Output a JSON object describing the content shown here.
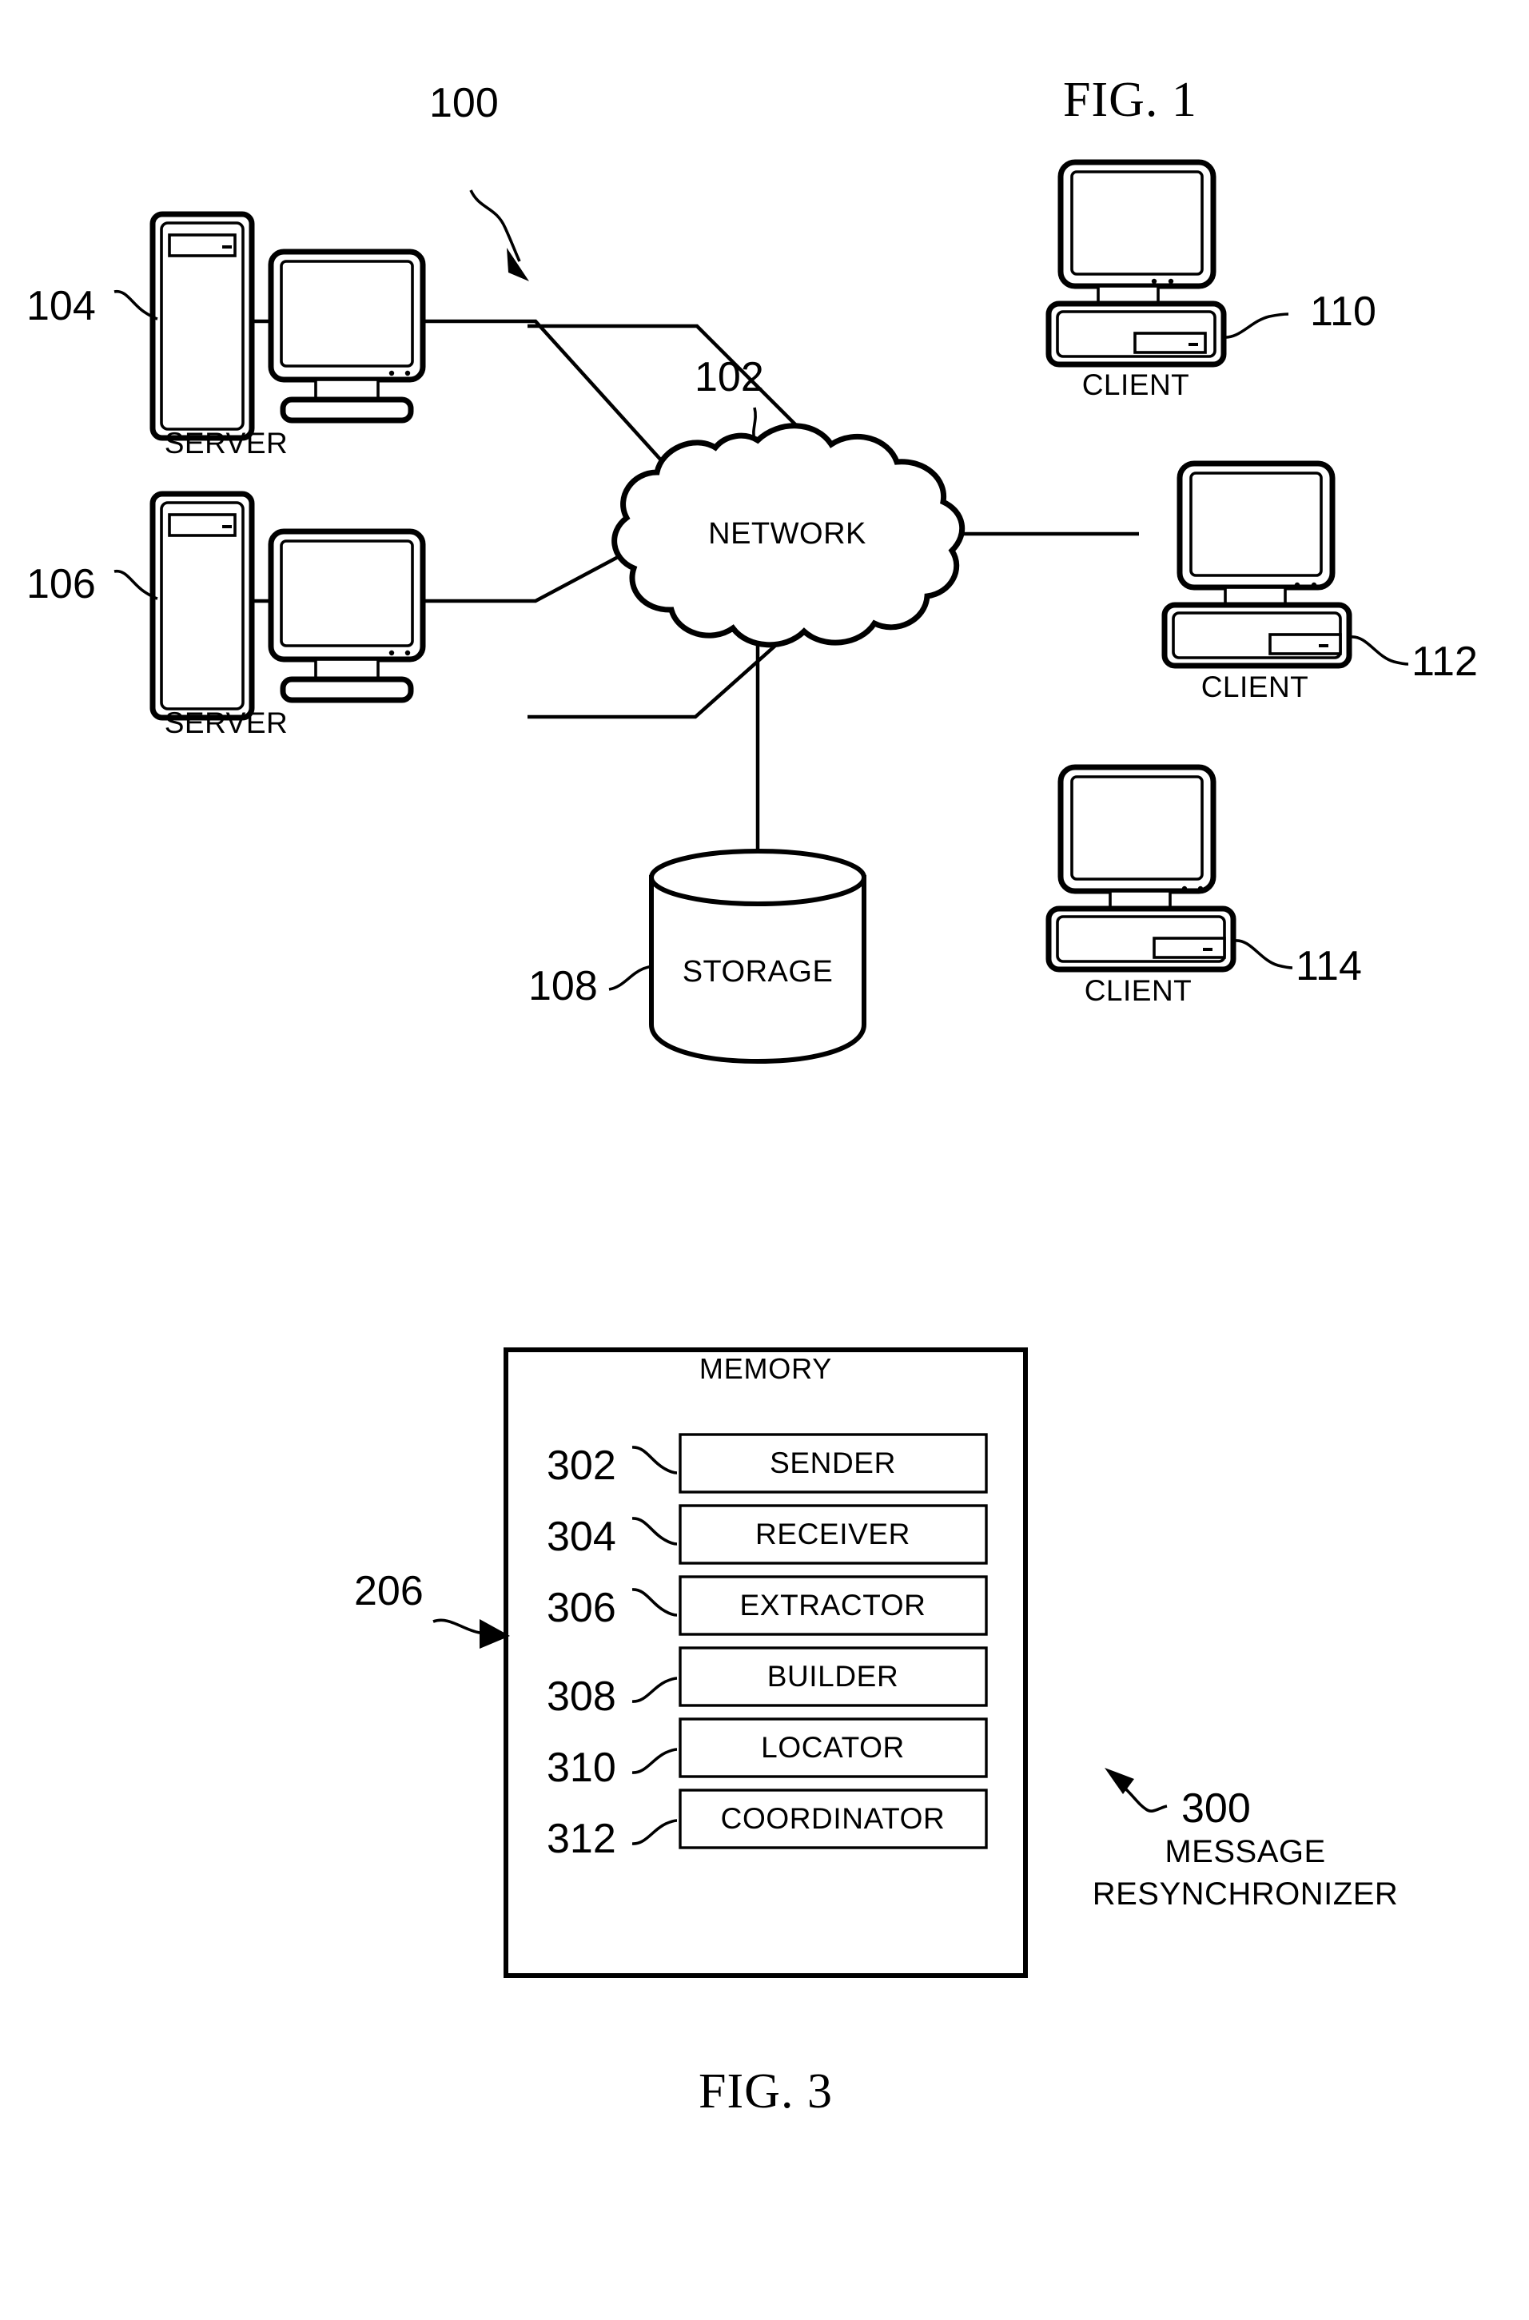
{
  "figures": [
    {
      "id": "fig1",
      "title": "FIG. 1",
      "system_ref": "100",
      "network": {
        "label": "NETWORK",
        "ref": "102"
      },
      "storage": {
        "label": "STORAGE",
        "ref": "108"
      },
      "servers": [
        {
          "label": "SERVER",
          "ref": "104"
        },
        {
          "label": "SERVER",
          "ref": "106"
        }
      ],
      "clients": [
        {
          "label": "CLIENT",
          "ref": "110"
        },
        {
          "label": "CLIENT",
          "ref": "112"
        },
        {
          "label": "CLIENT",
          "ref": "114"
        }
      ]
    },
    {
      "id": "fig3",
      "title": "FIG. 3",
      "memory_title": "MEMORY",
      "memory_ref": "206",
      "component_ref": "300",
      "component_name_line1": "MESSAGE",
      "component_name_line2": "RESYNCHRONIZER",
      "blocks": [
        {
          "ref": "302",
          "label": "SENDER"
        },
        {
          "ref": "304",
          "label": "RECEIVER"
        },
        {
          "ref": "306",
          "label": "EXTRACTOR"
        },
        {
          "ref": "308",
          "label": "BUILDER"
        },
        {
          "ref": "310",
          "label": "LOCATOR"
        },
        {
          "ref": "312",
          "label": "COORDINATOR"
        }
      ]
    }
  ],
  "colors": {
    "ink": "#000000",
    "paper": "#ffffff"
  }
}
